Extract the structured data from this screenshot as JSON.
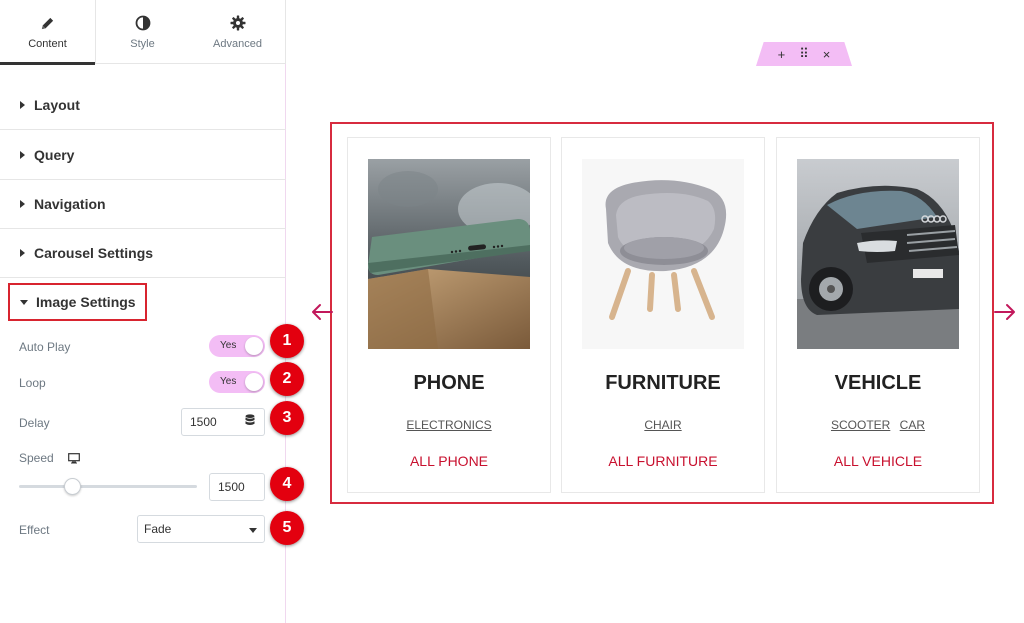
{
  "panel": {
    "tabs": [
      {
        "label": "Content",
        "icon": "pencil-icon"
      },
      {
        "label": "Style",
        "icon": "half-circle-icon"
      },
      {
        "label": "Advanced",
        "icon": "gear-icon"
      }
    ],
    "sections": [
      "Layout",
      "Query",
      "Navigation",
      "Carousel Settings"
    ],
    "image_settings": {
      "title": "Image Settings",
      "auto_play": {
        "label": "Auto Play",
        "value": "Yes"
      },
      "loop": {
        "label": "Loop",
        "value": "Yes"
      },
      "delay": {
        "label": "Delay",
        "value": "1500"
      },
      "speed": {
        "label": "Speed",
        "value": "1500",
        "slider_fraction": 0.3
      },
      "effect": {
        "label": "Effect",
        "value": "Fade"
      }
    },
    "badges": [
      "1",
      "2",
      "3",
      "4",
      "5"
    ]
  },
  "canvas": {
    "handle": {
      "add": "+",
      "move": "⠿",
      "close": "×"
    },
    "cards": [
      {
        "title": "PHONE",
        "links": [
          "ELECTRONICS"
        ],
        "all_link": "ALL PHONE",
        "image": "phone-image"
      },
      {
        "title": "FURNITURE",
        "links": [
          "CHAIR"
        ],
        "all_link": "ALL FURNITURE",
        "image": "chair-image"
      },
      {
        "title": "VEHICLE",
        "links": [
          "SCOOTER",
          "CAR"
        ],
        "all_link": "ALL VEHICLE",
        "image": "car-image"
      }
    ]
  },
  "colors": {
    "accent_pink": "#f3bdf5",
    "frame_red": "#d72b3f",
    "link_red": "#c8102e",
    "badge_red": "#e3000f",
    "arrow_color": "#c2185b"
  }
}
